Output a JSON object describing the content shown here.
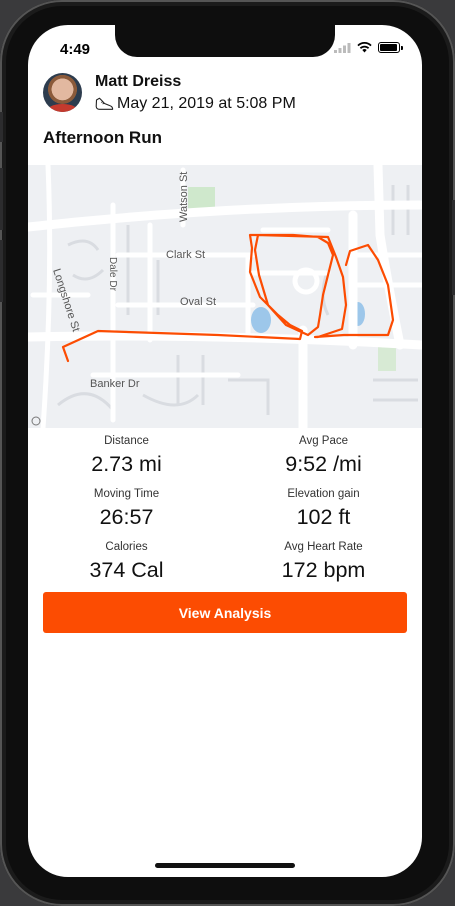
{
  "status_bar": {
    "time": "4:49"
  },
  "activity": {
    "athlete_name": "Matt Dreiss",
    "date": "May 21, 2019 at 5:08 PM",
    "activity_type_icon": "running-shoe-icon",
    "title": "Afternoon Run"
  },
  "map": {
    "streets": [
      "Watson St",
      "Clark St",
      "Dale Dr",
      "Oval St",
      "Longshore St",
      "Banker Dr"
    ],
    "route_color": "#fc4c02"
  },
  "stats": [
    {
      "label": "Distance",
      "value": "2.73 mi"
    },
    {
      "label": "Avg Pace",
      "value": "9:52 /mi"
    },
    {
      "label": "Moving Time",
      "value": "26:57"
    },
    {
      "label": "Elevation gain",
      "value": "102 ft"
    },
    {
      "label": "Calories",
      "value": "374 Cal"
    },
    {
      "label": "Avg Heart Rate",
      "value": "172 bpm"
    }
  ],
  "actions": {
    "view_analysis_label": "View Analysis"
  },
  "colors": {
    "accent": "#fc4c02",
    "background": "#ffffff"
  }
}
